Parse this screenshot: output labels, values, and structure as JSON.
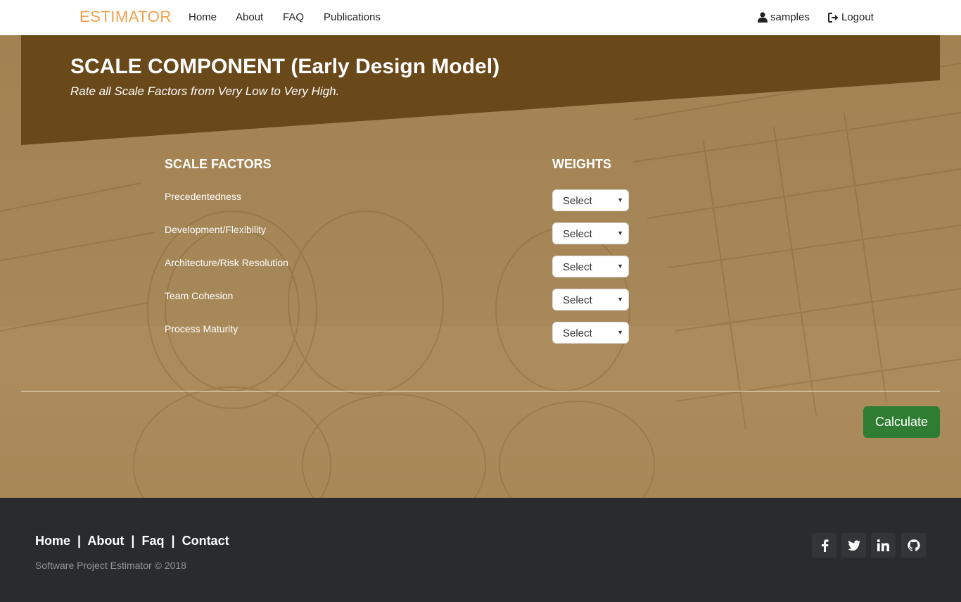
{
  "navbar": {
    "brand": "ESTIMATOR",
    "links": [
      "Home",
      "About",
      "FAQ",
      "Publications"
    ],
    "user_label": "samples",
    "logout_label": "Logout"
  },
  "header": {
    "title": "SCALE COMPONENT (Early Design Model)",
    "subtitle": "Rate all Scale Factors from Very Low to Very High."
  },
  "form": {
    "factors_heading": "SCALE FACTORS",
    "weights_heading": "WEIGHTS",
    "factors": [
      {
        "label": "Precedentedness",
        "selected": "Select"
      },
      {
        "label": "Development/Flexibility",
        "selected": "Select"
      },
      {
        "label": "Architecture/Risk Resolution",
        "selected": "Select"
      },
      {
        "label": "Team Cohesion",
        "selected": "Select"
      },
      {
        "label": "Process Maturity",
        "selected": "Select"
      }
    ],
    "calculate_label": "Calculate"
  },
  "footer": {
    "links": [
      "Home",
      "About",
      "Faq",
      "Contact"
    ],
    "separator": "|",
    "copyright": "Software Project Estimator © 2018",
    "social_icons": [
      "facebook-icon",
      "twitter-icon",
      "linkedin-icon",
      "github-icon"
    ]
  },
  "colors": {
    "banner": "#69481a",
    "accent_brand": "#f0a24a",
    "calculate": "#2e7d32",
    "footer": "#292b2f"
  }
}
